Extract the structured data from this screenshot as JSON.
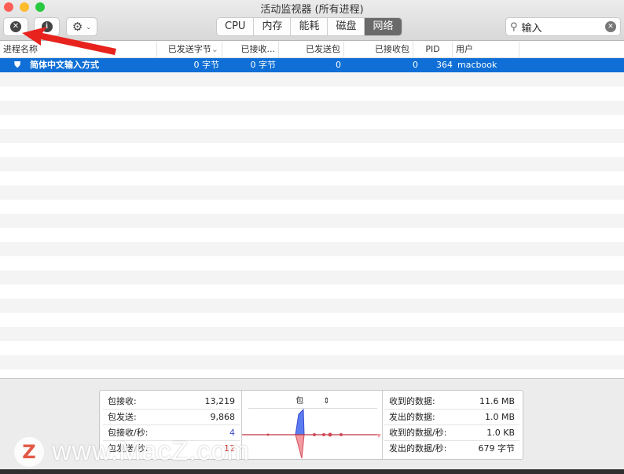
{
  "window": {
    "title": "活动监视器 (所有进程)"
  },
  "toolbar": {
    "tabs": [
      {
        "label": "CPU"
      },
      {
        "label": "内存"
      },
      {
        "label": "能耗"
      },
      {
        "label": "磁盘"
      },
      {
        "label": "网络",
        "active": true
      }
    ],
    "search_value": "输入"
  },
  "table": {
    "columns": [
      "进程名称",
      "已发送字节",
      "已接收...",
      "已发送包",
      "已接收包",
      "PID",
      "用户"
    ],
    "rows": [
      {
        "name": "简体中文输入方式",
        "sent_bytes": "0 字节",
        "recv_bytes": "0 字节",
        "sent_packets": "0",
        "recv_packets": "0",
        "pid": "364",
        "user": "macbook"
      }
    ]
  },
  "stats": {
    "left": [
      {
        "label": "包接收:",
        "value": "13,219"
      },
      {
        "label": "包发送:",
        "value": "9,868"
      },
      {
        "label": "包接收/秒:",
        "value": "4"
      },
      {
        "label": "包发送/秒:",
        "value": "12"
      }
    ],
    "graph_selector": "包",
    "right": [
      {
        "label": "收到的数据:",
        "value": "11.6 MB"
      },
      {
        "label": "发出的数据:",
        "value": "1.0 MB"
      },
      {
        "label": "收到的数据/秒:",
        "value": "1.0 KB"
      },
      {
        "label": "发出的数据/秒:",
        "value": "679 字节"
      }
    ]
  },
  "colors": {
    "selection": "#0f6fd6",
    "received": "#5b7cf0",
    "sent": "#f07a80"
  },
  "watermark": {
    "text": "www.MacZ.com",
    "logo": "Z"
  }
}
